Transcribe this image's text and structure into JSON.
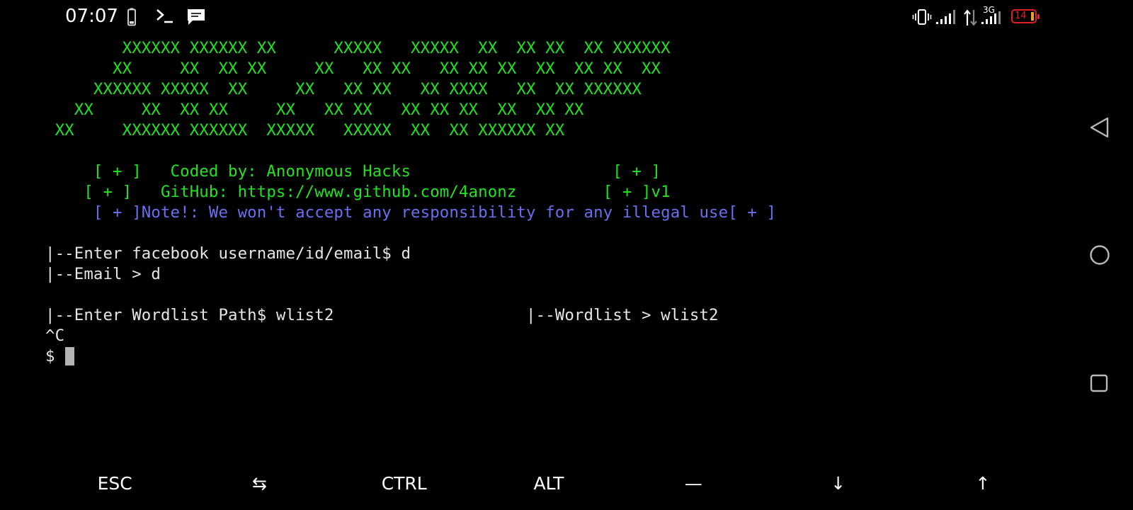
{
  "status_bar": {
    "time": "07:07",
    "network_type": "3G",
    "battery_level": "14",
    "icons": [
      "battery-small-icon",
      "terminal-prompt-icon",
      "chat-bubble-icon",
      "vibrate-icon",
      "signal-bars-icon",
      "data-arrows-icon",
      "signal-bars-icon",
      "battery-icon"
    ],
    "colors": {
      "battery_low": "#e02020",
      "battery_fill": "#f0a020"
    }
  },
  "terminal": {
    "colors": {
      "banner": "#22e222",
      "note": "#6a6ff0",
      "text": "#e6e6e6",
      "background": "#000000"
    },
    "banner_lines": [
      "        XXXXXX XXXXXX XX      XXXXX   XXXXX  XX  XX XX  XX XXXXXX",
      "       XX     XX  XX XX     XX   XX XX   XX XX XX  XX  XX XX  XX",
      "     XXXXXX XXXXX  XX     XX   XX XX   XX XXXX   XX  XX XXXXXX",
      "   XX     XX  XX XX     XX   XX XX   XX XX XX  XX  XX XX",
      " XX     XXXXXX XXXXXX  XXXXX   XXXXX  XX  XX XXXXXX XX"
    ],
    "info_lines": [
      "     [ + ]   Coded by: Anonymous Hacks                     [ + ]",
      "    [ + ]   GitHub: https://www.github.com/4anonz         [ + ]v1"
    ],
    "note_line": "     [ + ]Note!: We won't accept any responsibility for any illegal use[ + ]",
    "output_lines": [
      "|--Enter facebook username/id/email$ d",
      "|--Email > d",
      "",
      "|--Enter Wordlist Path$ wlist2                    |--Wordlist > wlist2",
      "^C"
    ],
    "prompt": "$"
  },
  "nav_bar": {
    "buttons": [
      "back-icon",
      "home-icon",
      "recents-icon"
    ]
  },
  "extra_keys": [
    {
      "label": "ESC",
      "name": "esc-key"
    },
    {
      "label": "⇆",
      "name": "tab-key"
    },
    {
      "label": "CTRL",
      "name": "ctrl-key"
    },
    {
      "label": "ALT",
      "name": "alt-key"
    },
    {
      "label": "—",
      "name": "dash-key"
    },
    {
      "label": "↓",
      "name": "arrow-down-key"
    },
    {
      "label": "↑",
      "name": "arrow-up-key"
    }
  ]
}
